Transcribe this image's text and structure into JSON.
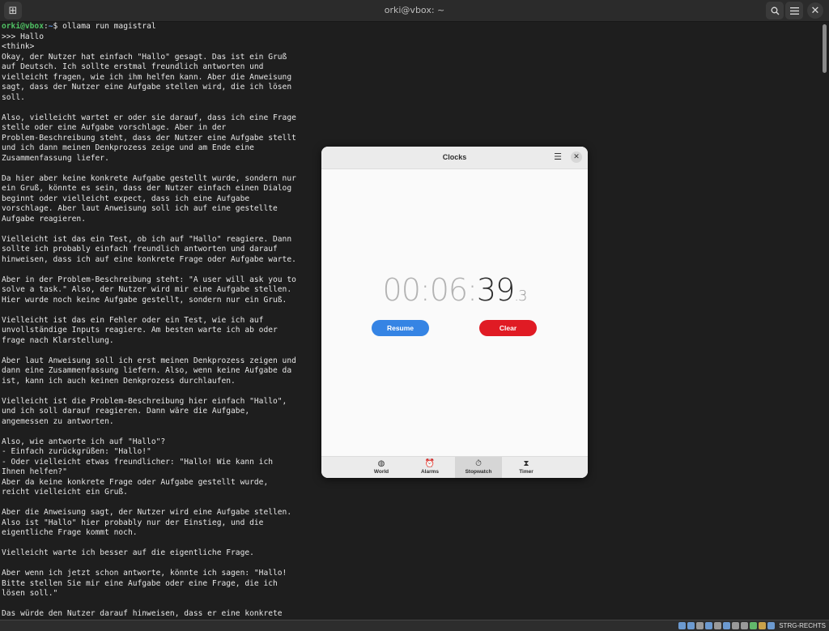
{
  "terminal": {
    "title": "orki@vbox: ~",
    "prompt": {
      "user": "orki@vbox",
      "path": "~",
      "symbol": "$",
      "command": "ollama run magistral"
    },
    "lines": [
      ">>> Hallo",
      "<think>",
      "Okay, der Nutzer hat einfach \"Hallo\" gesagt. Das ist ein Gruß",
      "auf Deutsch. Ich sollte erstmal freundlich antworten und",
      "vielleicht fragen, wie ich ihm helfen kann. Aber die Anweisung",
      "sagt, dass der Nutzer eine Aufgabe stellen wird, die ich lösen",
      "soll.",
      "",
      "Also, vielleicht wartet er oder sie darauf, dass ich eine Frage",
      "stelle oder eine Aufgabe vorschlage. Aber in der",
      "Problem-Beschreibung steht, dass der Nutzer eine Aufgabe stellt",
      "und ich dann meinen Denkprozess zeige und am Ende eine",
      "Zusammenfassung liefer.",
      "",
      "Da hier aber keine konkrete Aufgabe gestellt wurde, sondern nur",
      "ein Gruß, könnte es sein, dass der Nutzer einfach einen Dialog",
      "beginnt oder vielleicht expect, dass ich eine Aufgabe",
      "vorschlage. Aber laut Anweisung soll ich auf eine gestellte",
      "Aufgabe reagieren.",
      "",
      "Vielleicht ist das ein Test, ob ich auf \"Hallo\" reagiere. Dann",
      "sollte ich probably einfach freundlich antworten und darauf",
      "hinweisen, dass ich auf eine konkrete Frage oder Aufgabe warte.",
      "",
      "Aber in der Problem-Beschreibung steht: \"A user will ask you to",
      "solve a task.\" Also, der Nutzer wird mir eine Aufgabe stellen.",
      "Hier wurde noch keine Aufgabe gestellt, sondern nur ein Gruß.",
      "",
      "Vielleicht ist das ein Fehler oder ein Test, wie ich auf",
      "unvollständige Inputs reagiere. Am besten warte ich ab oder",
      "frage nach Klarstellung.",
      "",
      "Aber laut Anweisung soll ich erst meinen Denkprozess zeigen und",
      "dann eine Zusammenfassung liefern. Also, wenn keine Aufgabe da",
      "ist, kann ich auch keinen Denkprozess durchlaufen.",
      "",
      "Vielleicht ist die Problem-Beschreibung hier einfach \"Hallo\",",
      "und ich soll darauf reagieren. Dann wäre die Aufgabe,",
      "angemessen zu antworten.",
      "",
      "Also, wie antworte ich auf \"Hallo\"?",
      "- Einfach zurückgrüßen: \"Hallo!\"",
      "- Oder vielleicht etwas freundlicher: \"Hallo! Wie kann ich",
      "Ihnen helfen?\"",
      "Aber da keine konkrete Frage oder Aufgabe gestellt wurde,",
      "reicht vielleicht ein Gruß.",
      "",
      "Aber die Anweisung sagt, der Nutzer wird eine Aufgabe stellen.",
      "Also ist \"Hallo\" hier probably nur der Einstieg, und die",
      "eigentliche Frage kommt noch.",
      "",
      "Vielleicht warte ich besser auf die eigentliche Frage.",
      "",
      "Aber wenn ich jetzt schon antworte, könnte ich sagen: \"Hallo!",
      "Bitte stellen Sie mir eine Aufgabe oder eine Frage, die ich",
      "lösen soll.\"",
      "",
      "Das würde den Nutzer darauf hinweisen, dass er eine konkrete"
    ]
  },
  "clocks": {
    "title": "Clocks",
    "time": {
      "h": "00",
      "sep1": ":",
      "m": "06",
      "sep2": ":",
      "s": "39",
      "frac_dot": ".",
      "frac": "3"
    },
    "resume_label": "Resume",
    "clear_label": "Clear",
    "tabs": [
      {
        "label": "World",
        "icon": "globe-icon",
        "active": false
      },
      {
        "label": "Alarms",
        "icon": "alarm-icon",
        "active": false
      },
      {
        "label": "Stopwatch",
        "icon": "stopwatch-icon",
        "active": true
      },
      {
        "label": "Timer",
        "icon": "hourglass-icon",
        "active": false
      }
    ],
    "colors": {
      "resume": "#3584e4",
      "clear": "#e01b24"
    }
  },
  "taskbar": {
    "keyboard_label": "STRG-RECHTS"
  }
}
